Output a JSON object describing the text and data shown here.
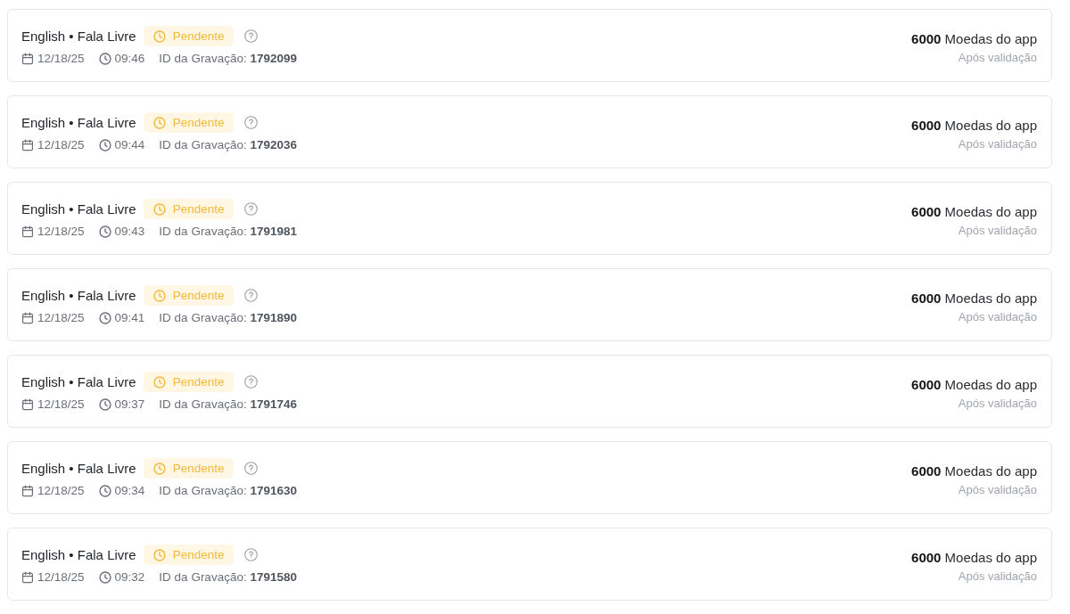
{
  "recordings": [
    {
      "title": "English • Fala Livre",
      "status": {
        "kind": "pending",
        "label": "Pendente"
      },
      "date": "12/18/25",
      "time": "09:46",
      "recording_id": "ID da Gravação: **1792099**",
      "reward": "**6000** Moedas do app",
      "reward_note": "Após validação"
    },
    {
      "title": "English • Fala Livre",
      "status": {
        "kind": "pending",
        "label": "Pendente"
      },
      "date": "12/18/25",
      "time": "09:44",
      "recording_id": "ID da Gravação: **1792036**",
      "reward": "**6000** Moedas do app",
      "reward_note": "Após validação"
    },
    {
      "title": "English • Fala Livre",
      "status": {
        "kind": "pending",
        "label": "Pendente"
      },
      "date": "12/18/25",
      "time": "09:43",
      "recording_id": "ID da Gravação: **1791981**",
      "reward": "**6000** Moedas do app",
      "reward_note": "Após validação"
    },
    {
      "title": "English • Fala Livre",
      "status": {
        "kind": "pending",
        "label": "Pendente"
      },
      "date": "12/18/25",
      "time": "09:41",
      "recording_id": "ID da Gravação: **1791890**",
      "reward": "**6000** Moedas do app",
      "reward_note": "Após validação"
    },
    {
      "title": "English • Fala Livre",
      "status": {
        "kind": "pending",
        "label": "Pendente"
      },
      "date": "12/18/25",
      "time": "09:37",
      "recording_id": "ID da Gravação: **1791746**",
      "reward": "**6000** Moedas do app",
      "reward_note": "Após validação"
    },
    {
      "title": "English • Fala Livre",
      "status": {
        "kind": "pending",
        "label": "Pendente"
      },
      "date": "12/18/25",
      "time": "09:34",
      "recording_id": "ID da Gravação: **1791630**",
      "reward": "**6000** Moedas do app",
      "reward_note": "Após validação"
    },
    {
      "title": "English • Fala Livre",
      "status": {
        "kind": "pending",
        "label": "Pendente"
      },
      "date": "12/18/25",
      "time": "09:32",
      "recording_id": "ID da Gravação: **1791580**",
      "reward": "**6000** Moedas do app",
      "reward_note": "Após validação"
    }
  ]
}
